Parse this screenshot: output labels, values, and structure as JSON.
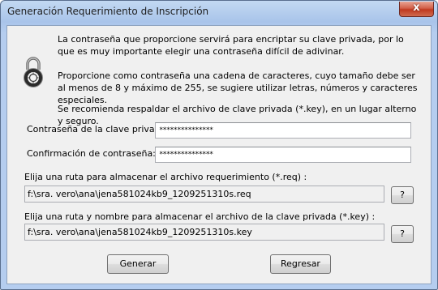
{
  "window": {
    "title": "Generación Requerimiento de Inscripción",
    "close_label": "x"
  },
  "info": {
    "paragraph1": "La contraseña que proporcione servirá para encriptar su clave privada, por lo que es muy importante elegir una contraseña difícil de adivinar.",
    "paragraph2": "Proporcione como contraseña una cadena de caracteres, cuyo tamaño debe ser al menos de 8 y máximo de 255, se sugiere utilizar letras, números y caracteres especiales.",
    "paragraph3": "Se recomienda respaldar el archivo de clave privada (*.key), en un lugar alterno y seguro."
  },
  "password": {
    "label": "Contraseña de la clave privada:",
    "value": "***************"
  },
  "confirm": {
    "label": "Confirmación de contraseña:",
    "value": "***************"
  },
  "req_path": {
    "label": "Elija una ruta para almacenar el archivo requerimiento (*.req) :",
    "value": "f:\\sra. vero\\ana\\jena581024kb9_1209251310s.req",
    "browse_label": "?"
  },
  "key_path": {
    "label": "Elija una ruta y nombre para almacenar el archivo de la clave privada (*.key) :",
    "value": "f:\\sra. vero\\ana\\jena581024kb9_1209251310s.key",
    "browse_label": "?"
  },
  "buttons": {
    "generate_label": "Generar",
    "back_label": "Regresar"
  }
}
